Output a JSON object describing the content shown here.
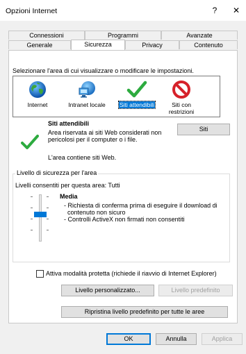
{
  "window": {
    "title": "Opzioni Internet",
    "help_glyph": "?",
    "close_glyph": "✕"
  },
  "tabs": {
    "row1": [
      {
        "label": "Connessioni",
        "active": false
      },
      {
        "label": "Programmi",
        "active": false
      },
      {
        "label": "Avanzate",
        "active": false
      }
    ],
    "row2": [
      {
        "label": "Generale",
        "active": false
      },
      {
        "label": "Sicurezza",
        "active": true
      },
      {
        "label": "Privacy",
        "active": false
      },
      {
        "label": "Contenuto",
        "active": false
      }
    ]
  },
  "zones": {
    "prompt": "Selezionare l'area di cui visualizzare o modificare le impostazioni.",
    "items": [
      {
        "label": "Internet",
        "icon": "globe-icon",
        "selected": false
      },
      {
        "label": "Intranet locale",
        "icon": "intranet-network-icon",
        "selected": false
      },
      {
        "label": "Siti attendibili",
        "icon": "checkmark-icon",
        "selected": true
      },
      {
        "label": "Siti con restrizioni",
        "label_line1": "Siti con",
        "label_line2": "restrizioni",
        "icon": "no-entry-icon",
        "selected": false
      }
    ]
  },
  "zone_info": {
    "title": "Siti attendibili",
    "description_line1": "Area riservata ai siti Web considerati non",
    "description_line2": "pericolosi per il computer o i file.",
    "contains_sites": "L'area contiene siti Web.",
    "sites_button": "Siti",
    "icon": "checkmark-icon"
  },
  "security_level": {
    "group_label": "Livello di sicurezza per l'area",
    "allowed_levels": "Livelli consentiti per questa area: Tutti",
    "level_name": "Media",
    "bullets": [
      "- Richiesta di conferma prima di eseguire il download di",
      "contenuto non sicuro",
      "- Controlli ActiveX non firmati non consentiti"
    ],
    "slider_level_index": 2,
    "slider_levels_total": 4,
    "protected_mode_label": "Attiva modalità protetta (richiede il riavvio di Internet Explorer)",
    "protected_mode_checked": false,
    "custom_level_button": "Livello personalizzato...",
    "default_level_button": "Livello predefinito",
    "reset_all_button": "Ripristina livello predefinito per tutte le aree"
  },
  "dialog_buttons": {
    "ok": "OK",
    "cancel": "Annulla",
    "apply": "Applica"
  },
  "colors": {
    "accent": "#0078d7",
    "check_green": "#2dab3f",
    "restricted_red": "#d6212a"
  }
}
